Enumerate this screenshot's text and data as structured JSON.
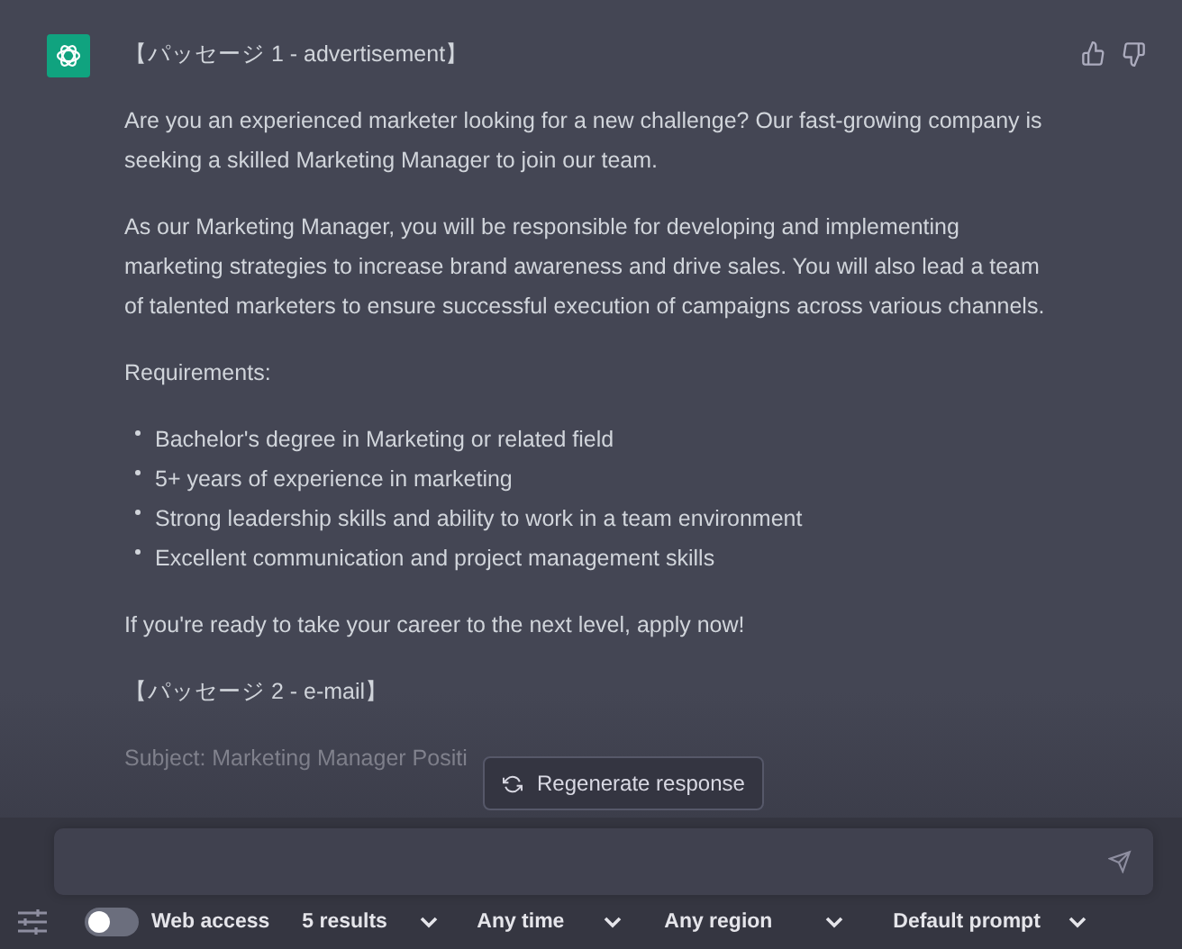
{
  "message": {
    "heading": "【パッセージ 1 - advertisement】",
    "blocks": [
      {
        "kind": "paragraph",
        "text": "Are you an experienced marketer looking for a new challenge? Our fast-growing company is seeking a skilled Marketing Manager to join our team."
      },
      {
        "kind": "paragraph",
        "text": "As our Marketing Manager, you will be responsible for developing and implementing marketing strategies to increase brand awareness and drive sales. You will also lead a team of talented marketers to ensure successful execution of campaigns across various channels."
      },
      {
        "kind": "paragraph",
        "text": "Requirements:"
      },
      {
        "kind": "list",
        "items": [
          "Bachelor's degree in Marketing or related field",
          "5+ years of experience in marketing",
          "Strong leadership skills and ability to work in a team environment",
          "Excellent communication and project management skills"
        ]
      },
      {
        "kind": "paragraph",
        "text": "If you're ready to take your career to the next level, apply now!"
      },
      {
        "kind": "paragraph",
        "text": "【パッセージ 2 - e-mail】"
      },
      {
        "kind": "paragraph",
        "text": "Subject: Marketing Manager Positi"
      }
    ]
  },
  "regenerate": {
    "label": "Regenerate response"
  },
  "composer": {
    "kind": "input"
  },
  "toolbar": {
    "web_access": {
      "label": "Web access",
      "on": false
    },
    "dropdowns": [
      {
        "label": "5 results"
      },
      {
        "label": "Any time"
      },
      {
        "label": "Any region"
      },
      {
        "label": "Default prompt"
      }
    ]
  }
}
